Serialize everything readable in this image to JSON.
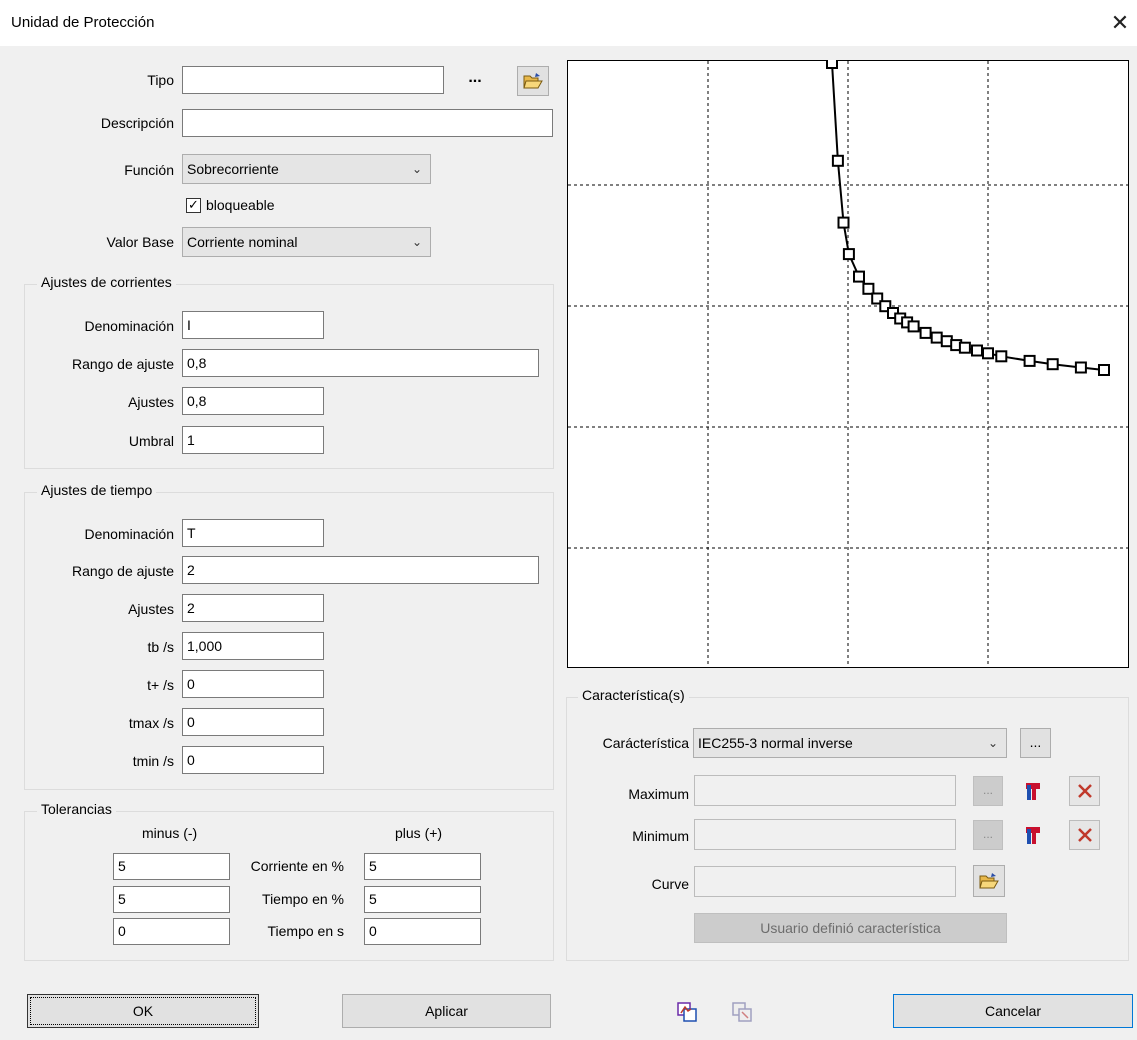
{
  "window": {
    "title": "Unidad de Protección",
    "close_glyph": "✕"
  },
  "general": {
    "tipo_label": "Tipo",
    "tipo_value": "",
    "tipo_browse": "...",
    "descripcion_label": "Descripción",
    "descripcion_value": "",
    "funcion_label": "Función",
    "funcion_value": "Sobrecorriente",
    "bloqueable_label": "bloqueable",
    "bloqueable_checked": true,
    "valor_base_label": "Valor Base",
    "valor_base_value": "Corriente nominal"
  },
  "ajustes_corrientes": {
    "title": "Ajustes de corrientes",
    "denominacion_label": "Denominación",
    "denominacion_value": "I",
    "rango_label": "Rango de ajuste",
    "rango_value": "0,8",
    "ajustes_label": "Ajustes",
    "ajustes_value": "0,8",
    "umbral_label": "Umbral",
    "umbral_value": "1"
  },
  "ajustes_tiempo": {
    "title": "Ajustes de tiempo",
    "denominacion_label": "Denominación",
    "denominacion_value": "T",
    "rango_label": "Rango de ajuste",
    "rango_value": "2",
    "ajustes_label": "Ajustes",
    "ajustes_value": "2",
    "tb_label": "tb  /s",
    "tb_value": "1,000",
    "tplus_label": "t+  /s",
    "tplus_value": "0",
    "tmax_label": "tmax  /s",
    "tmax_value": "0",
    "tmin_label": "tmin  /s",
    "tmin_value": "0"
  },
  "tolerancias": {
    "title": "Tolerancias",
    "minus_header": "minus (-)",
    "plus_header": "plus (+)",
    "rows": [
      {
        "label": "Corriente en %",
        "minus": "5",
        "plus": "5"
      },
      {
        "label": "Tiempo en %",
        "minus": "5",
        "plus": "5"
      },
      {
        "label": "Tiempo en s",
        "minus": "0",
        "plus": "0"
      }
    ]
  },
  "caracteristicas": {
    "title": "Característica(s)",
    "caracteristica_label": "Carácterística",
    "caracteristica_value": "IEC255-3 normal inverse",
    "more_button": "...",
    "maximum_label": "Maximum",
    "maximum_value": "",
    "minimum_label": "Minimum",
    "minimum_value": "",
    "curve_label": "Curve",
    "curve_value": "",
    "small_more": "...",
    "user_defined_button": "Usuario definió característica"
  },
  "footer": {
    "ok": "OK",
    "aplicar": "Aplicar",
    "cancelar": "Cancelar"
  },
  "chart_data": {
    "type": "line",
    "description": "Inverse time characteristic curve preview (no axis labels shown)",
    "grid": "dashed",
    "series": [
      {
        "values": [
          [
            1.05,
            100.0
          ],
          [
            1.1,
            30.0
          ],
          [
            1.15,
            14.0
          ],
          [
            1.2,
            9.5
          ],
          [
            1.3,
            7.2
          ],
          [
            1.4,
            6.2
          ],
          [
            1.5,
            5.5
          ],
          [
            1.6,
            5.0
          ],
          [
            1.7,
            4.6
          ],
          [
            1.8,
            4.3
          ],
          [
            1.9,
            4.1
          ],
          [
            2.0,
            3.9
          ],
          [
            2.2,
            3.6
          ],
          [
            2.4,
            3.4
          ],
          [
            2.6,
            3.25
          ],
          [
            2.8,
            3.1
          ],
          [
            3.0,
            3.0
          ],
          [
            3.3,
            2.9
          ],
          [
            3.6,
            2.8
          ],
          [
            4.0,
            2.7
          ],
          [
            5.0,
            2.55
          ],
          [
            6.0,
            2.45
          ],
          [
            7.5,
            2.35
          ],
          [
            9.0,
            2.28
          ]
        ]
      }
    ]
  }
}
